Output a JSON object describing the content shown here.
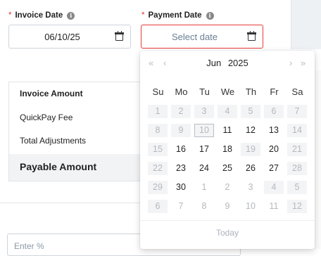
{
  "invoice_date": {
    "label": "Invoice Date",
    "required": "*",
    "info": "i",
    "value": "06/10/25"
  },
  "payment_date": {
    "label": "Payment Date",
    "required": "*",
    "info": "i",
    "placeholder": "Select date"
  },
  "summary": {
    "invoice_amount": "Invoice Amount",
    "quickpay_fee": "QuickPay Fee",
    "total_adjustments": "Total Adjustments",
    "payable_amount": "Payable Amount"
  },
  "percent_input": {
    "placeholder": "Enter %"
  },
  "datepicker": {
    "prev_year": "«",
    "prev_month": "‹",
    "next_month": "›",
    "next_year": "»",
    "month": "Jun",
    "year": "2025",
    "weekdays": [
      "Su",
      "Mo",
      "Tu",
      "We",
      "Th",
      "Fr",
      "Sa"
    ],
    "weeks": [
      [
        [
          "1",
          "d"
        ],
        [
          "2",
          "d"
        ],
        [
          "3",
          "d"
        ],
        [
          "4",
          "d"
        ],
        [
          "5",
          "d"
        ],
        [
          "6",
          "d"
        ],
        [
          "7",
          "d"
        ]
      ],
      [
        [
          "8",
          "d"
        ],
        [
          "9",
          "d"
        ],
        [
          "10",
          "t"
        ],
        [
          "11",
          "e"
        ],
        [
          "12",
          "e"
        ],
        [
          "13",
          "e"
        ],
        [
          "14",
          "d"
        ]
      ],
      [
        [
          "15",
          "d"
        ],
        [
          "16",
          "e"
        ],
        [
          "17",
          "e"
        ],
        [
          "18",
          "e"
        ],
        [
          "19",
          "d"
        ],
        [
          "20",
          "e"
        ],
        [
          "21",
          "d"
        ]
      ],
      [
        [
          "22",
          "d"
        ],
        [
          "23",
          "e"
        ],
        [
          "24",
          "e"
        ],
        [
          "25",
          "e"
        ],
        [
          "26",
          "e"
        ],
        [
          "27",
          "e"
        ],
        [
          "28",
          "d"
        ]
      ],
      [
        [
          "29",
          "d"
        ],
        [
          "30",
          "e"
        ],
        [
          "1",
          "o"
        ],
        [
          "2",
          "o"
        ],
        [
          "3",
          "o"
        ],
        [
          "4",
          "do"
        ],
        [
          "5",
          "do"
        ]
      ],
      [
        [
          "6",
          "do"
        ],
        [
          "7",
          "o"
        ],
        [
          "8",
          "o"
        ],
        [
          "9",
          "o"
        ],
        [
          "10",
          "o"
        ],
        [
          "11",
          "o"
        ],
        [
          "12",
          "do"
        ]
      ]
    ],
    "today_label": "Today"
  }
}
